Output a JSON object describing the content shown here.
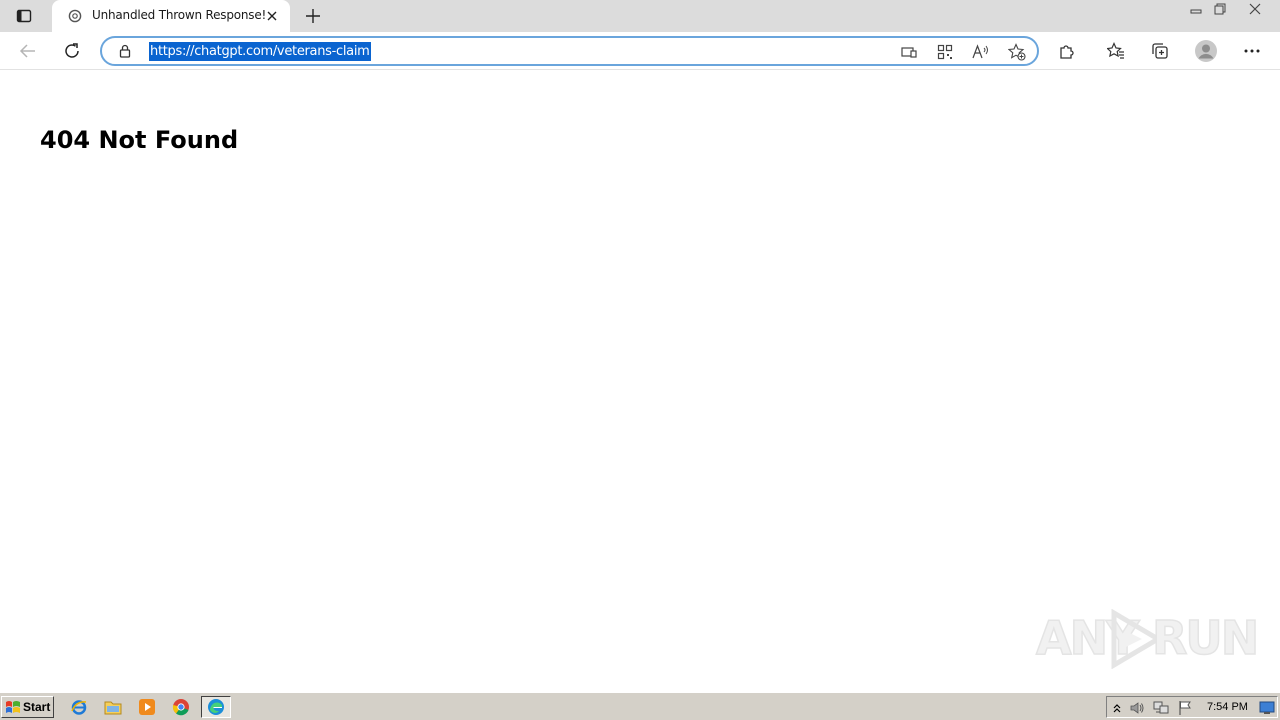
{
  "browser": {
    "tab": {
      "title": "Unhandled Thrown Response!",
      "favicon": "chatgpt-icon"
    },
    "address_bar": {
      "url": "https://chatgpt.com/veterans-claim"
    },
    "toolbar_icons": [
      "back-icon",
      "refresh-icon",
      "lock-icon",
      "app-available-icon",
      "qr-code-icon",
      "read-aloud-icon",
      "add-favorite-icon",
      "extensions-icon",
      "favorites-icon",
      "collections-icon",
      "profile-icon",
      "more-icon"
    ]
  },
  "page": {
    "heading": "404 Not Found"
  },
  "watermark": {
    "left": "ANY",
    "right": "RUN"
  },
  "taskbar": {
    "start_label": "Start",
    "apps": [
      "internet-explorer-icon",
      "explorer-folder-icon",
      "media-player-icon",
      "chrome-icon",
      "edge-icon"
    ],
    "clock": "7:54 PM"
  },
  "colors": {
    "url_highlight": "#0a64d0",
    "omnibox_border": "#6aa5dc",
    "taskbar": "#d4d0c8"
  }
}
